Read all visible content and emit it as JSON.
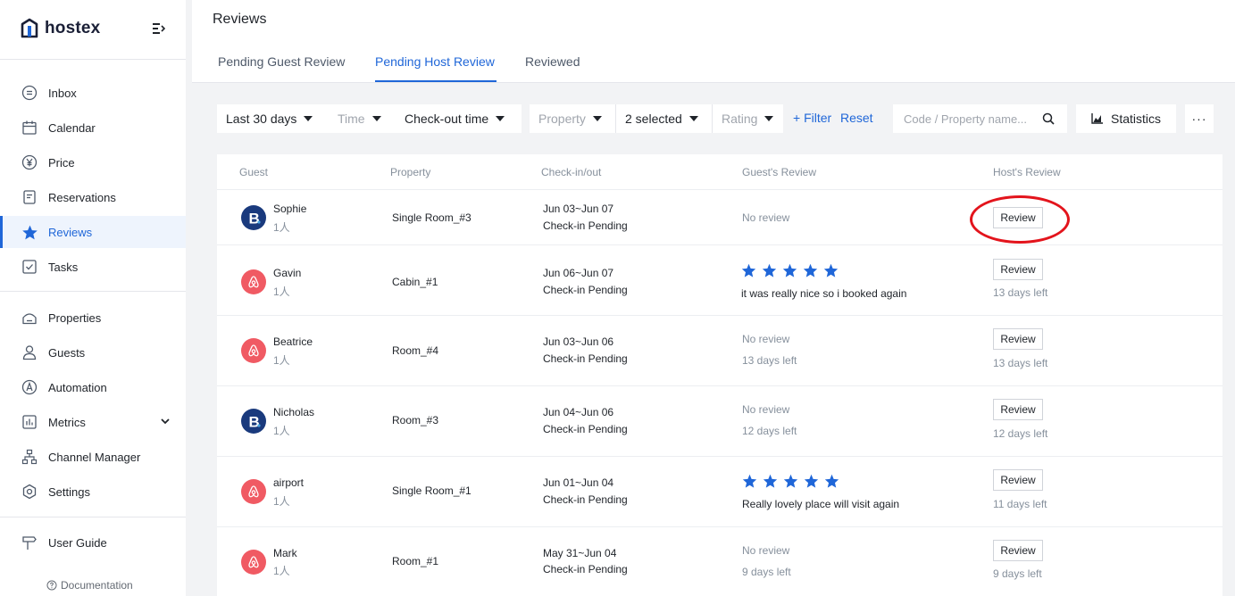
{
  "brand": {
    "name": "hostex"
  },
  "sidebar": {
    "items": [
      {
        "label": "Inbox",
        "icon": "inbox-icon"
      },
      {
        "label": "Calendar",
        "icon": "calendar-icon"
      },
      {
        "label": "Price",
        "icon": "yen-icon"
      },
      {
        "label": "Reservations",
        "icon": "document-icon"
      },
      {
        "label": "Reviews",
        "icon": "star-icon",
        "active": true
      },
      {
        "label": "Tasks",
        "icon": "checkbox-icon"
      },
      {
        "label": "Properties",
        "icon": "house-icon"
      },
      {
        "label": "Guests",
        "icon": "person-icon"
      },
      {
        "label": "Automation",
        "icon": "automation-icon"
      },
      {
        "label": "Metrics",
        "icon": "bar-chart-icon"
      },
      {
        "label": "Channel Manager",
        "icon": "network-icon"
      },
      {
        "label": "Settings",
        "icon": "gear-icon"
      },
      {
        "label": "User Guide",
        "icon": "signpost-icon"
      }
    ],
    "documentation": "Documentation"
  },
  "header": {
    "title": "Reviews",
    "tabs": [
      {
        "label": "Pending Guest Review"
      },
      {
        "label": "Pending Host Review",
        "active": true
      },
      {
        "label": "Reviewed"
      }
    ]
  },
  "filters": {
    "date_range": "Last 30 days",
    "time": "Time",
    "time_type": "Check-out time",
    "property": "Property",
    "selected": "2 selected",
    "rating": "Rating",
    "add_filter": "+ Filter",
    "reset": "Reset",
    "search_placeholder": "Code / Property name...",
    "statistics": "Statistics",
    "more": "···"
  },
  "table": {
    "columns": [
      "Guest",
      "Property",
      "Check-in/out",
      "Guest's Review",
      "Host's Review"
    ],
    "review_button": "Review",
    "rows": [
      {
        "guest": "Sophie",
        "count": "1人",
        "channel": "booking",
        "property": "Single Room_#3",
        "dates": "Jun 03~Jun 07",
        "status": "Check-in Pending",
        "guest_review": "No review",
        "guest_days": "",
        "stars": 0,
        "host_days": ""
      },
      {
        "guest": "Gavin",
        "count": "1人",
        "channel": "airbnb",
        "property": "Cabin_#1",
        "dates": "Jun 06~Jun 07",
        "status": "Check-in Pending",
        "guest_review": "it was really nice so i booked again",
        "guest_days": "",
        "stars": 5,
        "host_days": "13 days left"
      },
      {
        "guest": "Beatrice",
        "count": "1人",
        "channel": "airbnb",
        "property": "Room_#4",
        "dates": "Jun 03~Jun 06",
        "status": "Check-in Pending",
        "guest_review": "No review",
        "guest_days": "13 days left",
        "stars": 0,
        "host_days": "13 days left"
      },
      {
        "guest": "Nicholas",
        "count": "1人",
        "channel": "booking",
        "property": "Room_#3",
        "dates": "Jun 04~Jun 06",
        "status": "Check-in Pending",
        "guest_review": "No review",
        "guest_days": "12 days left",
        "stars": 0,
        "host_days": "12 days left"
      },
      {
        "guest": "airport",
        "count": "1人",
        "channel": "airbnb",
        "property": "Single Room_#1",
        "dates": "Jun 01~Jun 04",
        "status": "Check-in Pending",
        "guest_review": "Really lovely place will visit again",
        "guest_days": "",
        "stars": 5,
        "host_days": "11 days left"
      },
      {
        "guest": "Mark",
        "count": "1人",
        "channel": "airbnb",
        "property": "Room_#1",
        "dates": "May 31~Jun 04",
        "status": "Check-in Pending",
        "guest_review": "No review",
        "guest_days": "9 days left",
        "stars": 0,
        "host_days": "9 days left"
      }
    ]
  },
  "colors": {
    "accent": "#1f66d8",
    "booking": "#1a3a7d",
    "airbnb": "#f05a63",
    "star": "#1f66d8",
    "highlight": "#e3141c"
  }
}
